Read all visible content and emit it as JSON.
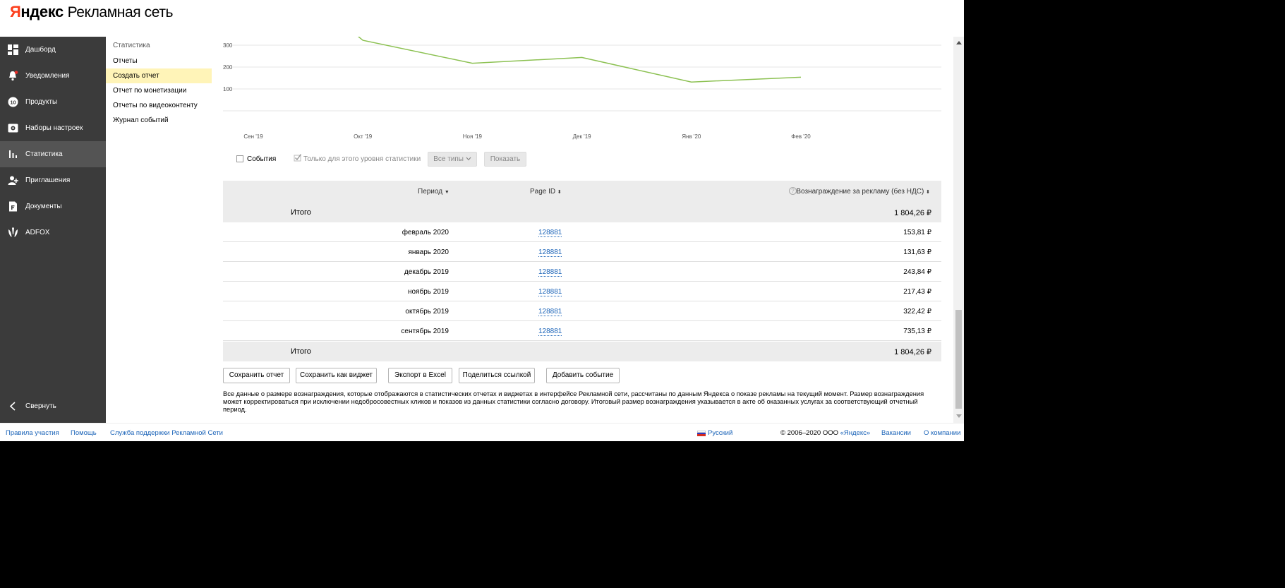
{
  "header": {
    "logo_brand_first": "Я",
    "logo_brand_rest": "ндекс",
    "logo_product": "Рекламная сеть"
  },
  "sidebar": {
    "items": [
      {
        "label": "Дашборд",
        "icon": "dashboard-icon"
      },
      {
        "label": "Уведомления",
        "icon": "bell-icon"
      },
      {
        "label": "Продукты",
        "icon": "products-icon"
      },
      {
        "label": "Наборы настроек",
        "icon": "settings-set-icon"
      },
      {
        "label": "Статистика",
        "icon": "bar-chart-icon",
        "active": true
      },
      {
        "label": "Приглашения",
        "icon": "invite-icon"
      },
      {
        "label": "Документы",
        "icon": "document-icon"
      },
      {
        "label": "ADFOX",
        "icon": "adfox-icon"
      }
    ],
    "collapse_label": "Свернуть"
  },
  "submenu": {
    "title": "Статистика",
    "items": [
      "Отчеты",
      "Создать отчет",
      "Отчет по монетизации",
      "Отчеты по видеоконтенту",
      "Журнал событий"
    ],
    "active_index": 1
  },
  "chart_data": {
    "type": "line",
    "categories": [
      "Сен '19",
      "Окт '19",
      "Ноя '19",
      "Дек '19",
      "Янв '20",
      "Фев '20"
    ],
    "series": [
      {
        "values": [
          735.13,
          322.42,
          217.43,
          243.84,
          131.63,
          153.81
        ],
        "color": "#8cc152"
      }
    ],
    "y_ticks": [
      "300",
      "200",
      "100"
    ],
    "ylim": [
      0,
      400
    ],
    "grid": true
  },
  "filters": {
    "events_label": "События",
    "level_only_label": "Только для этого уровня статистики",
    "types_button": "Все типы",
    "show_button": "Показать"
  },
  "table": {
    "headers": {
      "period": "Период",
      "page_id": "Page ID",
      "reward": "Вознаграждение за рекламу (без НДС)"
    },
    "total_label": "Итого",
    "total_value": "1 804,26 ₽",
    "rows": [
      {
        "period": "февраль 2020",
        "page_id": "128881",
        "reward": "153,81 ₽"
      },
      {
        "period": "январь 2020",
        "page_id": "128881",
        "reward": "131,63 ₽"
      },
      {
        "period": "декабрь 2019",
        "page_id": "128881",
        "reward": "243,84 ₽"
      },
      {
        "period": "ноябрь 2019",
        "page_id": "128881",
        "reward": "217,43 ₽"
      },
      {
        "period": "октябрь 2019",
        "page_id": "128881",
        "reward": "322,42 ₽"
      },
      {
        "period": "сентябрь 2019",
        "page_id": "128881",
        "reward": "735,13 ₽"
      }
    ]
  },
  "actions": {
    "save_report": "Сохранить отчет",
    "save_widget": "Сохранить как виджет",
    "export_excel": "Экспорт в Excel",
    "share_link": "Поделиться ссылкой",
    "add_event": "Добавить событие"
  },
  "disclaimer": "Все данные о размере вознаграждения, которые отображаются в статистических отчетах и виджетах в интерфейсе Рекламной сети, рассчитаны по данным Яндекса о показе рекламы на текущий момент. Размер вознаграждения может корректироваться при исключении недобросовестных кликов и показов из данных статистики согласно договору. Итоговый размер вознаграждения указывается в акте об оказанных услугах за соответствующий отчетный период.",
  "footer": {
    "rules": "Правила участия",
    "help": "Помощь",
    "support": "Служба поддержки Рекламной Сети",
    "language": "Русский",
    "copyright_prefix": "© 2006–2020 ООО ",
    "copyright_company": "«Яндекс»",
    "jobs": "Вакансии",
    "about": "О компании"
  },
  "colors": {
    "sidebar_bg": "#3b3b3b",
    "sidebar_active": "#545454",
    "submenu_active": "#fff4b8",
    "link": "#1a63b8",
    "chart_line": "#8cc152",
    "table_header_bg": "#ececec",
    "yandex_red": "#fc3f1d"
  }
}
